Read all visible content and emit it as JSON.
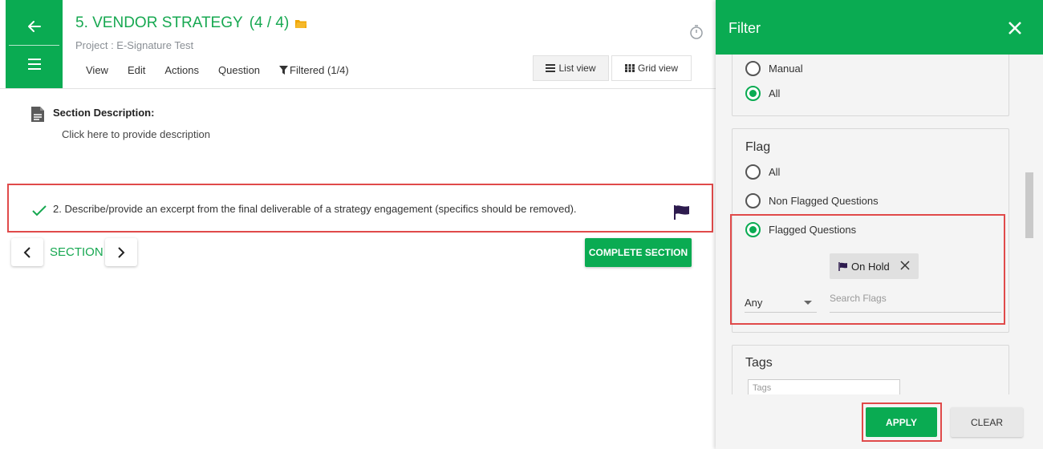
{
  "header": {
    "title": "5. VENDOR STRATEGY",
    "title_count": "(4 / 4)",
    "project": "Project : E-Signature Test",
    "menu": {
      "view": "View",
      "edit": "Edit",
      "actions": "Actions",
      "question": "Question",
      "filtered": "Filtered (1/4)"
    },
    "list_view": "List view",
    "grid_view": "Grid view"
  },
  "section": {
    "description_label": "Section Description:",
    "description_hint": "Click here to provide description",
    "nav_label": "SECTION",
    "complete_button": "COMPLETE SECTION"
  },
  "question": {
    "text": "2. Describe/provide an excerpt from the final deliverable of a strategy engagement (specifics should be removed).",
    "flag_color": "#2d1b4e"
  },
  "filter_panel": {
    "title": "Filter",
    "type_options": [
      {
        "label": "Manual",
        "selected": false
      },
      {
        "label": "All",
        "selected": true
      }
    ],
    "flag": {
      "title": "Flag",
      "options": [
        {
          "label": "All",
          "selected": false
        },
        {
          "label": "Non Flagged Questions",
          "selected": false
        },
        {
          "label": "Flagged Questions",
          "selected": true
        }
      ],
      "chip_label": "On Hold",
      "match_select": "Any",
      "search_placeholder": "Search Flags"
    },
    "tags": {
      "title": "Tags",
      "placeholder": "Tags"
    },
    "apply_button": "APPLY",
    "clear_button": "CLEAR"
  },
  "colors": {
    "primary_green": "#0aab52",
    "highlight_red": "#e04a4a",
    "title_green": "#17a851",
    "folder_orange": "#f0a500"
  }
}
